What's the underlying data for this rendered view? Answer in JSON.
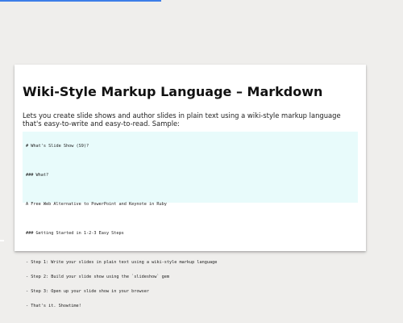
{
  "load_progress": 0.4,
  "colors": {
    "page_background": "#efeeec",
    "progress": "#3d7ee8",
    "slide_background": "#ffffff",
    "code_background": "#e8fbfb"
  },
  "slide": {
    "title": "Wiki-Style Markup Language – Markdown",
    "intro": "Lets you create slide shows and author slides in plain text using a wiki-style markup language that's easy-to-write and easy-to-read. Sample:",
    "code_lines": [
      "# What's Slide Show (S9)?",
      "",
      "### What?",
      "",
      "A Free Web Alternative to PowerPoint and Keynote in Ruby",
      "",
      "### Getting Started in 1-2-3 Easy Steps",
      "",
      "- Step 1: Write your slides in plain text using a wiki-style markup language",
      "- Step 2: Build your slide show using the `slideshow` gem",
      "- Step 3: Open up your slide show in your browser",
      "- That's it. Showtime!"
    ]
  }
}
